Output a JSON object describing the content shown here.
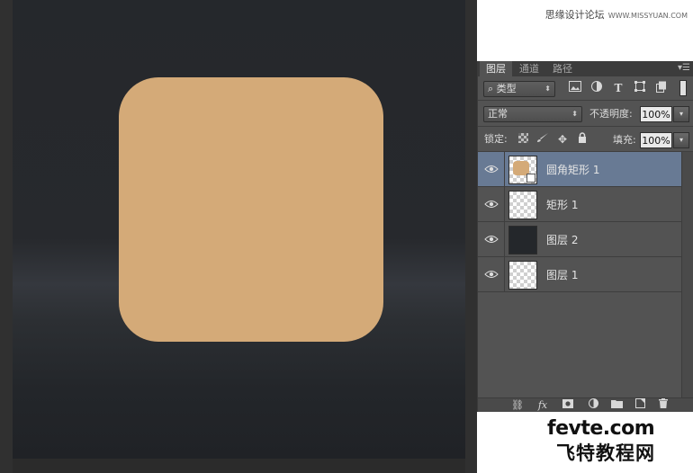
{
  "watermark": {
    "top_text": "思缘设计论坛",
    "top_url": "WWW.MISSYUAN.COM",
    "bottom_logo": "fevte.com",
    "bottom_logo_cn": "飞特教程网"
  },
  "canvas": {
    "shape_color": "#d4aa78"
  },
  "layers_panel": {
    "tabs": [
      {
        "label": "图层",
        "active": true
      },
      {
        "label": "通道",
        "active": false
      },
      {
        "label": "路径",
        "active": false
      }
    ],
    "menu_icon": "panel-menu-icon",
    "filter": {
      "search_glyph": "⌕",
      "kind_label": "类型",
      "filter_icons": [
        "image-filter-icon",
        "adjustment-filter-icon",
        "type-filter-icon",
        "shape-filter-icon",
        "smart-object-filter-icon"
      ]
    },
    "blend_mode": "正常",
    "opacity_label": "不透明度:",
    "opacity_value": "100%",
    "lock_label": "锁定:",
    "lock_icons": [
      "lock-transparent-icon",
      "lock-paint-icon",
      "lock-position-icon",
      "lock-all-icon"
    ],
    "fill_label": "填充:",
    "fill_value": "100%",
    "layers": [
      {
        "name": "圆角矩形 1",
        "selected": true,
        "thumb": "shape",
        "visible": true
      },
      {
        "name": "矩形 1",
        "selected": false,
        "thumb": "transparent",
        "visible": true
      },
      {
        "name": "图层 2",
        "selected": false,
        "thumb": "dark",
        "visible": true
      },
      {
        "name": "图层 1",
        "selected": false,
        "thumb": "transparent",
        "visible": true
      }
    ],
    "footer_icons": [
      "link-layers-icon",
      "fx-icon",
      "add-mask-icon",
      "new-adjustment-icon",
      "new-group-icon",
      "new-layer-icon",
      "delete-icon"
    ],
    "footer_fx": "fx"
  },
  "colors": {
    "selection": "#687a94",
    "panel_bg": "#535353",
    "accent_shape": "#d4aa78"
  }
}
